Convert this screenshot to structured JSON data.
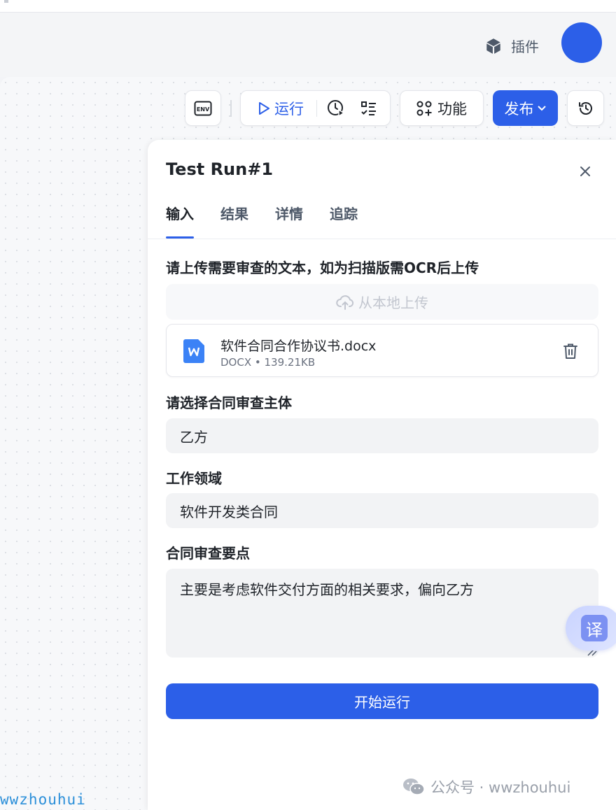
{
  "header": {
    "plugin_label": "插件",
    "plugin_icon": "cube-icon",
    "avatar_color": "#2c5fe8"
  },
  "toolbar": {
    "env_label": "ENV",
    "run_label": "运行",
    "function_label": "功能",
    "publish_label": "发布",
    "accent_color": "#2c5fe8"
  },
  "panel": {
    "title": "Test Run#1",
    "tabs": [
      {
        "label": "输入",
        "active": true
      },
      {
        "label": "结果",
        "active": false
      },
      {
        "label": "详情",
        "active": false
      },
      {
        "label": "追踪",
        "active": false
      }
    ],
    "upload": {
      "label": "请上传需要审查的文本，如为扫描版需OCR后上传",
      "button_label": "从本地上传",
      "file": {
        "name": "软件合同合作协议书.docx",
        "type": "DOCX",
        "size": "139.21KB"
      }
    },
    "subject": {
      "label": "请选择合同审查主体",
      "value": "乙方"
    },
    "domain": {
      "label": "工作领域",
      "value": "软件开发类合同"
    },
    "key_points": {
      "label": "合同审查要点",
      "value": "主要是考虑软件交付方面的相关要求，偏向乙方"
    },
    "start_button": "开始运行"
  },
  "translate_bubble": "译",
  "watermarks": {
    "left": "wwzhouhui",
    "right": "公众号 · wwzhouhui"
  }
}
